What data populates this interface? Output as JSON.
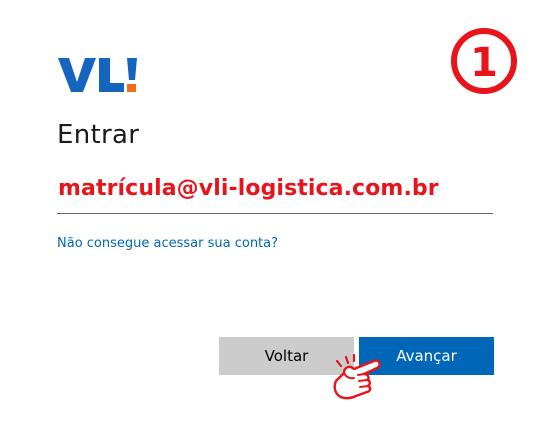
{
  "brand": {
    "logo_text": "VL!",
    "logo_colors": {
      "letters": "#1565c0",
      "exclamation": "#f26b1d"
    }
  },
  "step_badge": {
    "label": "1",
    "color": "#e8141b"
  },
  "signin": {
    "title": "Entrar",
    "account_field": {
      "value": "matrícula@vli-logistica.com.br",
      "value_color": "#e8141b"
    },
    "help_link": "Não consegue acessar sua conta?",
    "buttons": {
      "back_label": "Voltar",
      "next_label": "Avançar"
    }
  },
  "colors": {
    "accent": "#0067b8",
    "secondary_button": "#cccccc",
    "annotation": "#e8141b"
  },
  "annotation": {
    "icon": "pointing-hand-icon"
  }
}
